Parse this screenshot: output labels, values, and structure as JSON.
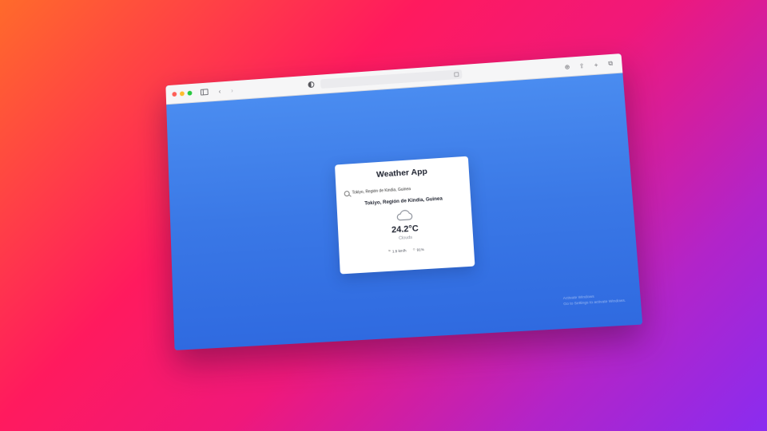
{
  "browser": {
    "url": "",
    "toolbar_icons": [
      "sidebar-icon",
      "back-icon",
      "forward-icon",
      "privacy-icon",
      "download-icon",
      "share-icon",
      "new-tab-icon",
      "tabs-overview-icon"
    ]
  },
  "app": {
    "title": "Weather App",
    "search": {
      "value": "Tokiyo, Región de Kindia, Guinea",
      "placeholder": ""
    },
    "location": "Tokiyo, Región de Kindia, Guinea",
    "temperature": "24.2°C",
    "condition": "Clouds",
    "details": {
      "wind": "1.5 km/h",
      "humidity": "91%"
    }
  },
  "watermark": {
    "line1": "Activate Windows",
    "line2": "Go to Settings to activate Windows."
  },
  "colors": {
    "page_background_start": "#ff6a2b",
    "page_background_end": "#8a2cf0",
    "app_background": "#3a78e6",
    "card": "#ffffff"
  }
}
